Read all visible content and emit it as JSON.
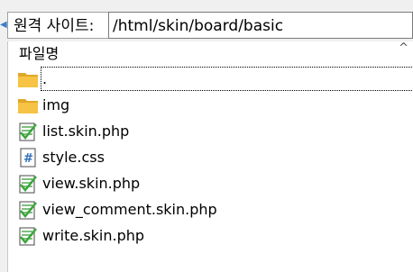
{
  "remote_site": {
    "label": "원격 사이트:",
    "path": "/html/skin/board/basic"
  },
  "file_list": {
    "column_header": "파일명",
    "sort_indicator": "^",
    "items": [
      {
        "name": ".",
        "icon": "folder-icon",
        "selected": true
      },
      {
        "name": "img",
        "icon": "folder-icon",
        "selected": false
      },
      {
        "name": "list.skin.php",
        "icon": "php-file-icon",
        "selected": false
      },
      {
        "name": "style.css",
        "icon": "css-file-icon",
        "selected": false
      },
      {
        "name": "view.skin.php",
        "icon": "php-file-icon",
        "selected": false
      },
      {
        "name": "view_comment.skin.php",
        "icon": "php-file-icon",
        "selected": false
      },
      {
        "name": "write.skin.php",
        "icon": "php-file-icon",
        "selected": false
      }
    ]
  },
  "colors": {
    "folder": "#f6c344",
    "folder_dark": "#e0a82a",
    "php_green": "#3aa63a",
    "css_blue": "#2c6fb7"
  }
}
